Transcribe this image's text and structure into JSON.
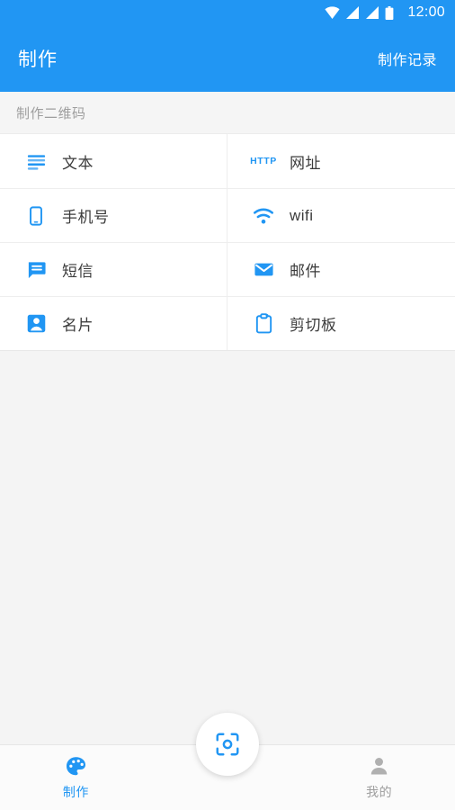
{
  "theme": {
    "primary": "#2196f3",
    "accent": "#2196f3",
    "inactive": "#9e9e9e",
    "page_background": "#f4f4f4",
    "card_background": "#ffffff"
  },
  "status_bar": {
    "time": "12:00",
    "icons": [
      "wifi-icon",
      "signal-icon",
      "signal-icon",
      "battery-icon"
    ]
  },
  "app_bar": {
    "title": "制作",
    "action_label": "制作记录"
  },
  "section": {
    "header": "制作二维码"
  },
  "grid": {
    "rows": [
      {
        "left": {
          "label": "文本",
          "icon": "text-lines-icon"
        },
        "right": {
          "label": "网址",
          "icon": "http-icon",
          "icon_text": "HTTP"
        }
      },
      {
        "left": {
          "label": "手机号",
          "icon": "phone-icon"
        },
        "right": {
          "label": "wifi",
          "icon": "wifi-icon"
        }
      },
      {
        "left": {
          "label": "短信",
          "icon": "sms-bubble-icon"
        },
        "right": {
          "label": "邮件",
          "icon": "envelope-icon"
        }
      },
      {
        "left": {
          "label": "名片",
          "icon": "contact-card-icon"
        },
        "right": {
          "label": "剪切板",
          "icon": "clipboard-icon"
        }
      }
    ]
  },
  "bottom_nav": {
    "items": [
      {
        "label": "制作",
        "icon": "palette-icon",
        "active": true
      },
      {
        "label": "我的",
        "icon": "person-icon",
        "active": false
      }
    ],
    "fab": {
      "icon": "scan-qr-icon"
    }
  }
}
